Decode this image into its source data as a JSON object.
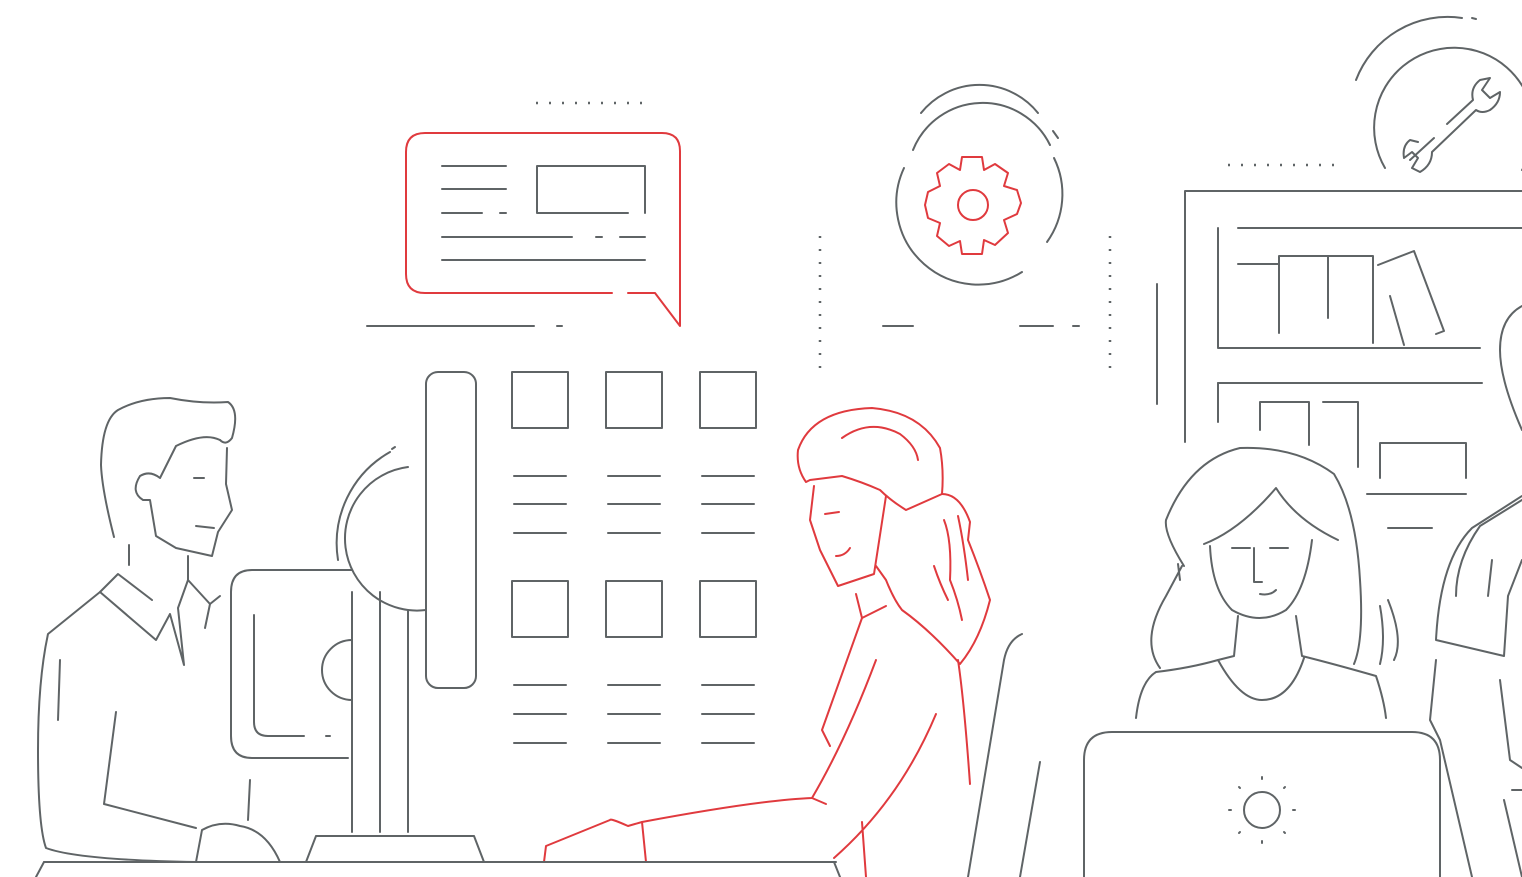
{
  "illustration": {
    "colors": {
      "line": "#5f6466",
      "accent": "#e03a3e",
      "background": "#ffffff"
    },
    "icons": [
      "chat-bubble-icon",
      "gear-icon",
      "wrench-icon",
      "laptop-logo-icon"
    ]
  }
}
